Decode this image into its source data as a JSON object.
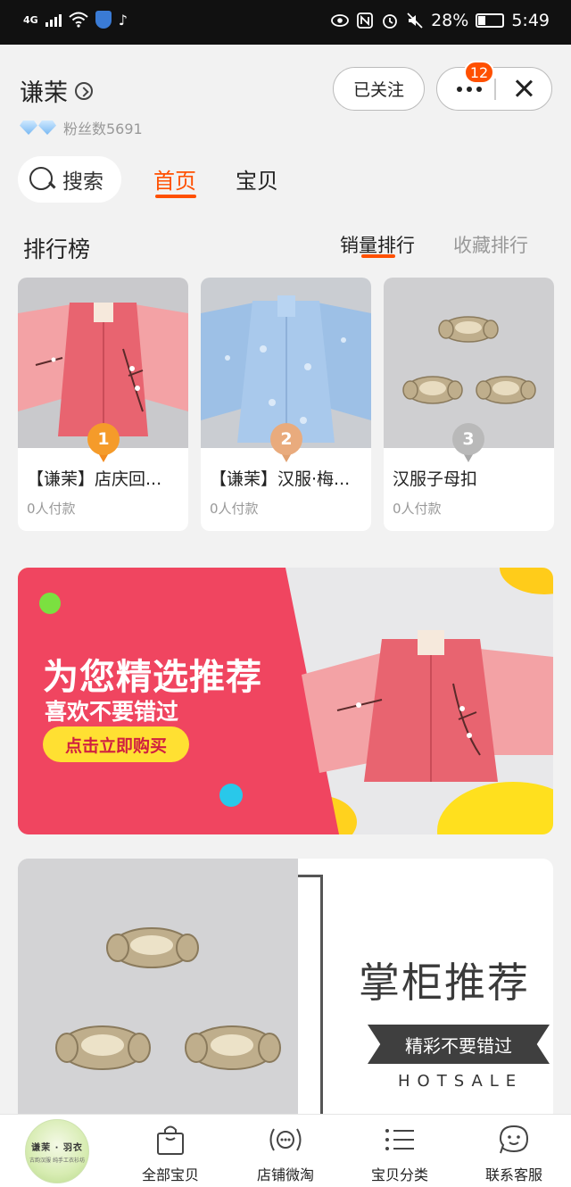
{
  "status_bar": {
    "network": "4G",
    "battery": "28%",
    "time": "5:49"
  },
  "shop": {
    "name": "谦茉",
    "fans": "粉丝数5691"
  },
  "header": {
    "follow_label": "已关注",
    "badge_count": "12"
  },
  "tabs": {
    "search_label": "搜索",
    "home": "首页",
    "items": "宝贝"
  },
  "ranking": {
    "title": "排行榜",
    "sort_sales": "销量排行",
    "sort_fav": "收藏排行",
    "items": [
      {
        "rank": "1",
        "name": "【谦茉】店庆回...",
        "payments": "0人付款"
      },
      {
        "rank": "2",
        "name": "【谦茉】汉服·梅...",
        "payments": "0人付款"
      },
      {
        "rank": "3",
        "name": "汉服子母扣",
        "payments": "0人付款"
      }
    ]
  },
  "banner": {
    "title": "为您精选推荐",
    "subtitle": "喜欢不要错过",
    "cta": "点击立即购买"
  },
  "recommend": {
    "title": "掌柜推荐",
    "ribbon": "精彩不要错过",
    "hot": "HOTSALE"
  },
  "bottom_nav": {
    "logo_text": "谦茉 · 羽衣",
    "logo_small": "古韵汉服  纯手工衣衫坊",
    "items": [
      {
        "label": "全部宝贝",
        "icon": "shopping-bag-icon"
      },
      {
        "label": "店铺微淘",
        "icon": "broadcast-icon"
      },
      {
        "label": "宝贝分类",
        "icon": "list-icon"
      },
      {
        "label": "联系客服",
        "icon": "chat-bubble-icon"
      }
    ]
  },
  "colors": {
    "accent": "#ff5000",
    "banner_red": "#f04560",
    "cta_yellow": "#ffe032"
  }
}
